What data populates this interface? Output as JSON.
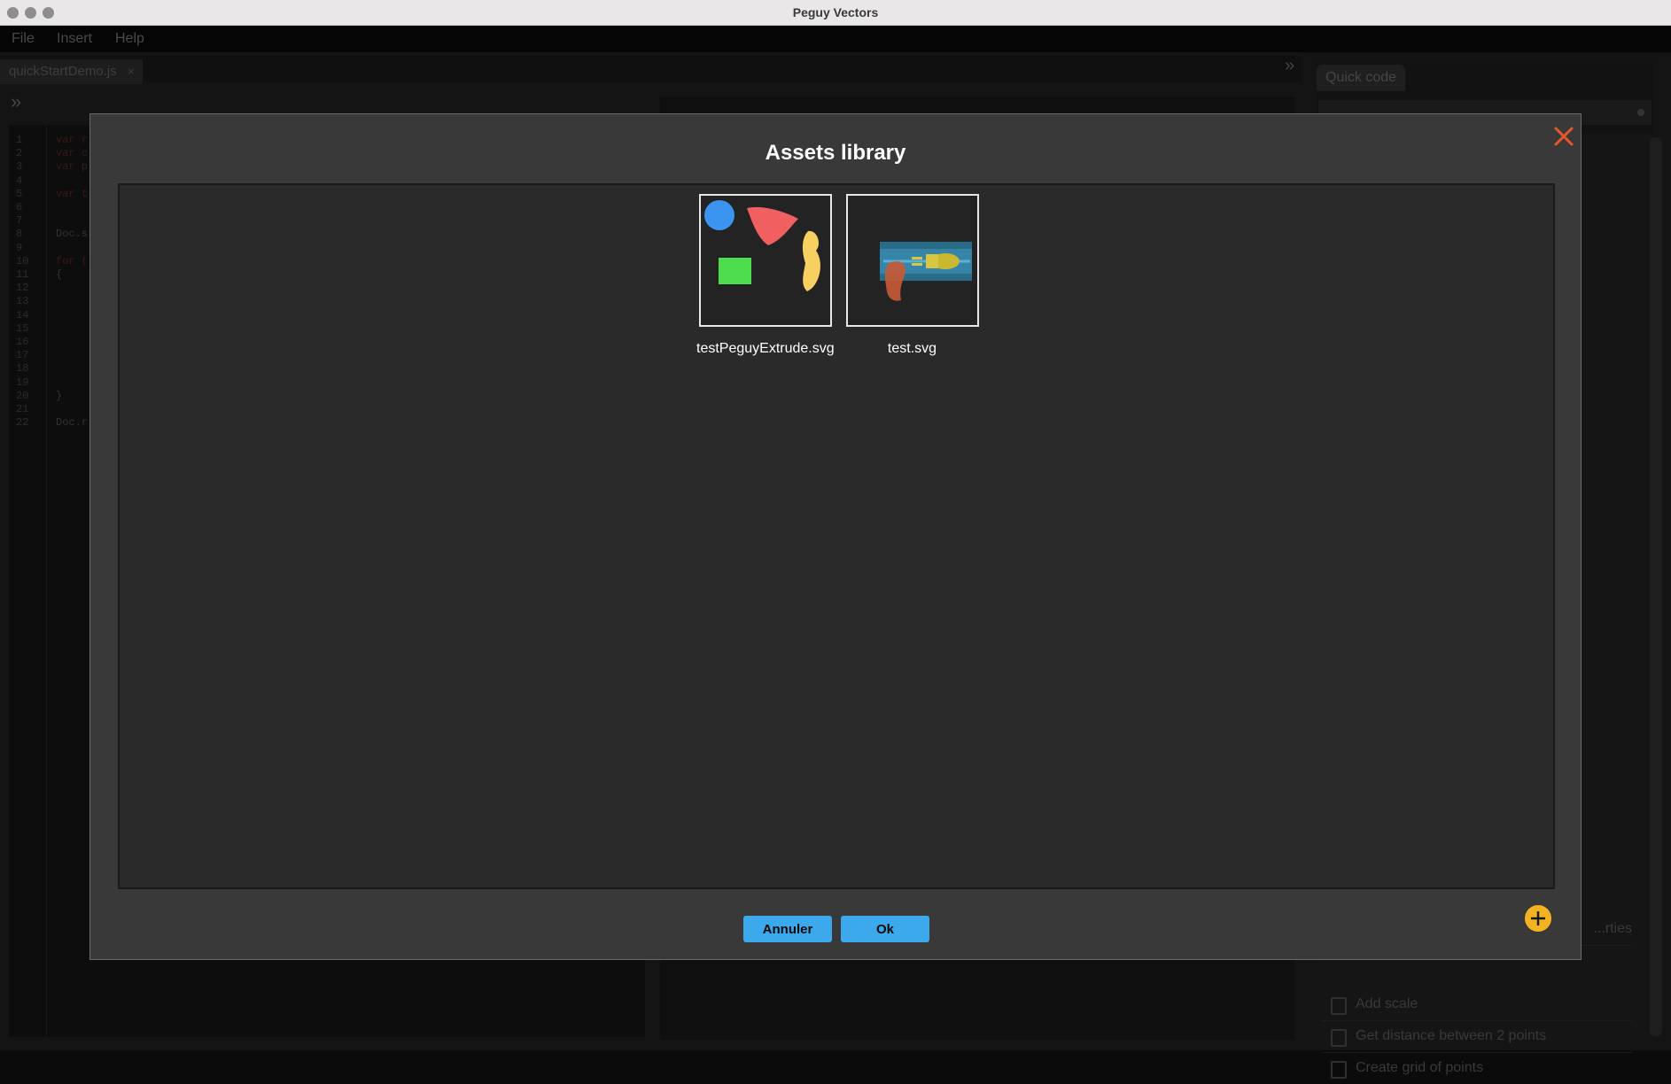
{
  "window": {
    "title": "Peguy Vectors"
  },
  "menu": [
    "File",
    "Insert",
    "Help"
  ],
  "editor": {
    "tab_label": "quickStartDemo.js",
    "tab_close": "×",
    "line_numbers": [
      "1",
      "2",
      "3",
      "4",
      "5",
      "6",
      "7",
      "8",
      "9",
      "10",
      "11",
      "12",
      "13",
      "14",
      "15",
      "16",
      "17",
      "18",
      "19",
      "20",
      "21",
      "22"
    ],
    "code_lines": [
      {
        "line": 1,
        "text": "var r"
      },
      {
        "line": 2,
        "text": "var c"
      },
      {
        "line": 3,
        "text": "var p"
      },
      {
        "line": 5,
        "text": "var t"
      },
      {
        "line": 8,
        "text": "Doc.s"
      },
      {
        "line": 10,
        "text": "for ("
      },
      {
        "line": 11,
        "text": "{"
      },
      {
        "line": 20,
        "text": "}"
      },
      {
        "line": 22,
        "text": "Doc.r"
      }
    ]
  },
  "side_panel": {
    "tab_label": "Quick code",
    "visible_items": [
      {
        "label": "...rties",
        "partial": true
      },
      {
        "label": "Add scale"
      },
      {
        "label": "Get distance between 2 points"
      },
      {
        "label": "Create grid of points"
      }
    ]
  },
  "dialog": {
    "title": "Assets library",
    "assets": [
      {
        "name": "testPeguyExtrude.svg"
      },
      {
        "name": "test.svg"
      }
    ],
    "buttons": {
      "cancel": "Annuler",
      "ok": "Ok"
    },
    "icons": {
      "close": "close-icon",
      "add": "plus-circle-icon"
    }
  },
  "colors": {
    "accent_button": "#3ba9ec",
    "close_icon": "#e8562a",
    "add_button": "#f4b321",
    "modal_bg": "#393939",
    "assets_bg": "#2a2a2a"
  }
}
